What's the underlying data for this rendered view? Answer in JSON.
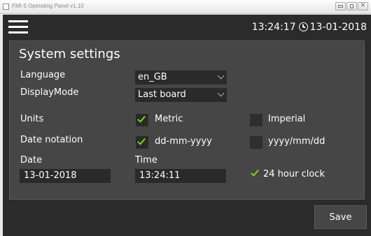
{
  "window": {
    "title": "FMI-5 Operating Panel v1.10"
  },
  "header": {
    "time": "13:24:17",
    "date": "13-01-2018"
  },
  "settings": {
    "title": "System settings",
    "language": {
      "label": "Language",
      "value": "en_GB"
    },
    "display_mode": {
      "label": "DisplayMode",
      "value": "Last board"
    },
    "units": {
      "label": "Units",
      "metric_label": "Metric",
      "metric_checked": true,
      "imperial_label": "Imperial",
      "imperial_checked": false
    },
    "date_notation": {
      "label": "Date notation",
      "option1_label": "dd-mm-yyyy",
      "option1_checked": true,
      "option2_label": "yyyy/mm/dd",
      "option2_checked": false
    },
    "date": {
      "label": "Date",
      "value": "13-01-2018"
    },
    "time": {
      "label": "Time",
      "value": "13:24:11"
    },
    "clock24": {
      "label": "24 hour clock",
      "checked": true
    }
  },
  "footer": {
    "save_label": "Save"
  },
  "colors": {
    "background": "#2b2b2b",
    "panel": "#464646",
    "field": "#2a2a2a",
    "check_accent": "#7ed321"
  }
}
